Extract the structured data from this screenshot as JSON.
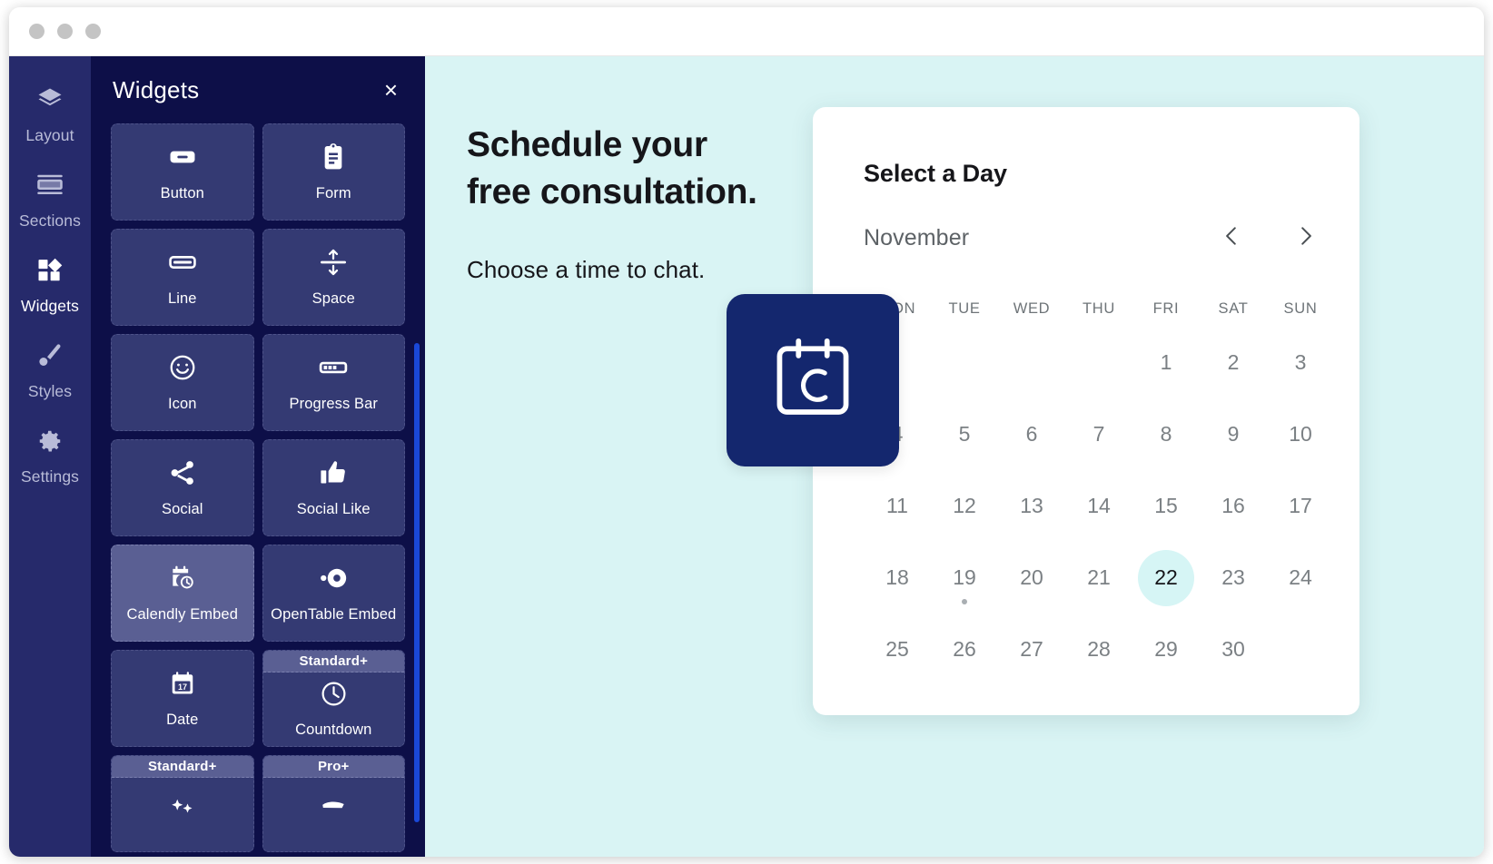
{
  "window": {
    "traffic_dots": [
      "close",
      "minimize",
      "maximize"
    ]
  },
  "rail": {
    "items": [
      {
        "label": "Layout",
        "icon": "layers-icon",
        "active": false
      },
      {
        "label": "Sections",
        "icon": "sections-icon",
        "active": false
      },
      {
        "label": "Widgets",
        "icon": "widgets-icon",
        "active": true
      },
      {
        "label": "Styles",
        "icon": "brush-icon",
        "active": false
      },
      {
        "label": "Settings",
        "icon": "gear-icon",
        "active": false
      }
    ]
  },
  "panel": {
    "title": "Widgets",
    "close_label": "×",
    "widgets": [
      {
        "label": "Button",
        "icon": "button-icon",
        "badge": null,
        "selected": false
      },
      {
        "label": "Form",
        "icon": "form-icon",
        "badge": null,
        "selected": false
      },
      {
        "label": "Line",
        "icon": "line-icon",
        "badge": null,
        "selected": false
      },
      {
        "label": "Space",
        "icon": "space-icon",
        "badge": null,
        "selected": false
      },
      {
        "label": "Icon",
        "icon": "smiley-icon",
        "badge": null,
        "selected": false
      },
      {
        "label": "Progress Bar",
        "icon": "progress-bar-icon",
        "badge": null,
        "selected": false
      },
      {
        "label": "Social",
        "icon": "share-icon",
        "badge": null,
        "selected": false
      },
      {
        "label": "Social Like",
        "icon": "thumbs-up-icon",
        "badge": null,
        "selected": false
      },
      {
        "label": "Calendly Embed",
        "icon": "calendar-clock-icon",
        "badge": null,
        "selected": true
      },
      {
        "label": "OpenTable Embed",
        "icon": "opentable-icon",
        "badge": null,
        "selected": false
      },
      {
        "label": "Date",
        "icon": "calendar-17-icon",
        "badge": null,
        "selected": false
      },
      {
        "label": "Countdown",
        "icon": "clock-icon",
        "badge": "Standard+",
        "selected": false
      },
      {
        "label": "",
        "icon": "stars-icon",
        "badge": "Standard+",
        "selected": false
      },
      {
        "label": "",
        "icon": "ribbon-icon",
        "badge": "Pro+",
        "selected": false
      }
    ]
  },
  "canvas": {
    "hero": {
      "title_line1": "Schedule your",
      "title_line2": "free consultation.",
      "subtitle": "Choose a time to chat."
    },
    "logo": {
      "icon": "calendly-logo-icon"
    },
    "calendar": {
      "title": "Select a Day",
      "month": "November",
      "prev_label": "‹",
      "next_label": "›",
      "dow": [
        "MON",
        "TUE",
        "WED",
        "THU",
        "FRI",
        "SAT",
        "SUN"
      ],
      "leading_blanks": 4,
      "days": [
        {
          "n": "1",
          "selected": false,
          "dot": false
        },
        {
          "n": "2",
          "selected": false,
          "dot": false
        },
        {
          "n": "3",
          "selected": false,
          "dot": false
        },
        {
          "n": "4",
          "selected": false,
          "dot": false
        },
        {
          "n": "5",
          "selected": false,
          "dot": false
        },
        {
          "n": "6",
          "selected": false,
          "dot": false
        },
        {
          "n": "7",
          "selected": false,
          "dot": false
        },
        {
          "n": "8",
          "selected": false,
          "dot": false
        },
        {
          "n": "9",
          "selected": false,
          "dot": false
        },
        {
          "n": "10",
          "selected": false,
          "dot": false
        },
        {
          "n": "11",
          "selected": false,
          "dot": false
        },
        {
          "n": "12",
          "selected": false,
          "dot": false
        },
        {
          "n": "13",
          "selected": false,
          "dot": false
        },
        {
          "n": "14",
          "selected": false,
          "dot": false
        },
        {
          "n": "15",
          "selected": false,
          "dot": false
        },
        {
          "n": "16",
          "selected": false,
          "dot": false
        },
        {
          "n": "17",
          "selected": false,
          "dot": false
        },
        {
          "n": "18",
          "selected": false,
          "dot": false
        },
        {
          "n": "19",
          "selected": false,
          "dot": true
        },
        {
          "n": "20",
          "selected": false,
          "dot": false
        },
        {
          "n": "21",
          "selected": false,
          "dot": false
        },
        {
          "n": "22",
          "selected": true,
          "dot": false
        },
        {
          "n": "23",
          "selected": false,
          "dot": false
        },
        {
          "n": "24",
          "selected": false,
          "dot": false
        },
        {
          "n": "25",
          "selected": false,
          "dot": false
        },
        {
          "n": "26",
          "selected": false,
          "dot": false
        },
        {
          "n": "27",
          "selected": false,
          "dot": false
        },
        {
          "n": "28",
          "selected": false,
          "dot": false
        },
        {
          "n": "29",
          "selected": false,
          "dot": false
        },
        {
          "n": "30",
          "selected": false,
          "dot": false
        }
      ]
    }
  },
  "colors": {
    "rail_bg": "#262A6B",
    "panel_bg": "#0D0F48",
    "tile_bg": "#343A73",
    "tile_selected_bg": "#5A5F93",
    "canvas_bg": "#D9F4F4",
    "scrollbar": "#1A48D8",
    "calendly_navy": "#14276E",
    "selected_day_bg": "#D6F5F5"
  }
}
